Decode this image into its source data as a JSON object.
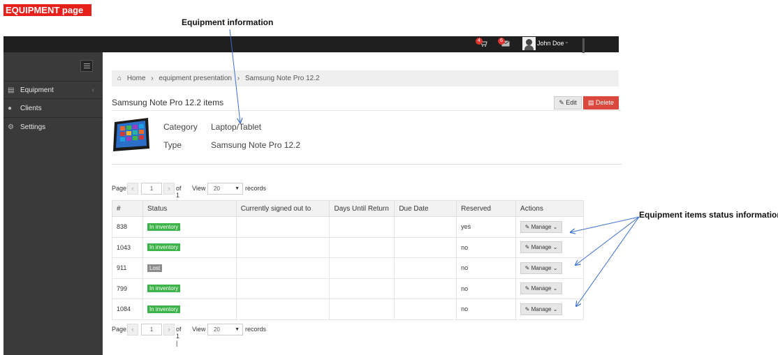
{
  "annotations": {
    "page_tag": "EQUIPMENT page",
    "equipment_information": "Equipment information",
    "items_status_information": "Equipment items status information"
  },
  "topbar": {
    "cart_badge": "4",
    "mail_badge": "6",
    "user_name": "John Doe"
  },
  "sidebar": {
    "items": [
      {
        "label": "Equipment",
        "icon": "list-icon"
      },
      {
        "label": "Clients",
        "icon": "user-icon"
      },
      {
        "label": "Settings",
        "icon": "gears-icon"
      }
    ]
  },
  "breadcrumb": {
    "home": "Home",
    "level1": "equipment presentation",
    "level2": "Samsung Note Pro 12.2"
  },
  "page_title": "Samsung Note Pro 12.2 items",
  "actions": {
    "edit": "Edit",
    "delete": "Delete"
  },
  "info": {
    "category_label": "Category",
    "category_value": "Laptop/Tablet",
    "type_label": "Type",
    "type_value": "Samsung Note Pro 12.2"
  },
  "pager": {
    "page_label": "Page",
    "page": "1",
    "of_label": "of 1 |",
    "view_label": "View",
    "per_page": "20",
    "records_label": "records"
  },
  "table": {
    "headers": [
      "#",
      "Status",
      "Currently signed out to",
      "Days Until Return",
      "Due Date",
      "Reserved",
      "Actions"
    ],
    "manage_label": "Manage",
    "rows": [
      {
        "id": "838",
        "status": "In inventory",
        "status_kind": "ok",
        "signed_out": "",
        "days": "",
        "due": "",
        "reserved": "yes"
      },
      {
        "id": "1043",
        "status": "In inventory",
        "status_kind": "ok",
        "signed_out": "",
        "days": "",
        "due": "",
        "reserved": "no"
      },
      {
        "id": "911",
        "status": "Lost",
        "status_kind": "lost",
        "signed_out": "",
        "days": "",
        "due": "",
        "reserved": "no"
      },
      {
        "id": "799",
        "status": "In inventory",
        "status_kind": "ok",
        "signed_out": "",
        "days": "",
        "due": "",
        "reserved": "no"
      },
      {
        "id": "1084",
        "status": "In inventory",
        "status_kind": "ok",
        "signed_out": "",
        "days": "",
        "due": "",
        "reserved": "no"
      }
    ]
  },
  "colors": {
    "status_ok": "#3cb44a",
    "status_lost": "#8c8c8c",
    "delete": "#d9473d",
    "annotation_tag": "#e8201b",
    "arrow": "#3a6fd1"
  }
}
